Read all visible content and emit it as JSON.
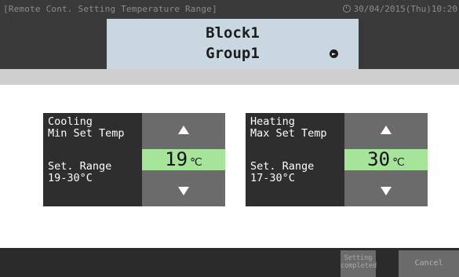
{
  "header": {
    "screen_title": "[Remote Cont. Setting Temperature Range]",
    "datetime": "30/04/2015(Thu)10:20",
    "block_name": "Block1",
    "group_name": "Group1"
  },
  "cooling": {
    "mode_label": "Cooling\nMin Set Temp",
    "value": "19",
    "unit": "℃",
    "range_label": "Set. Range",
    "range_value": "19-30°C"
  },
  "heating": {
    "mode_label": "Heating\nMax Set Temp",
    "value": "30",
    "unit": "℃",
    "range_label": "Set. Range",
    "range_value": "17-30°C"
  },
  "footer": {
    "setting_completed_label": "Setting completed",
    "cancel_label": "Cancel"
  },
  "icons": {
    "clock": "clock-icon",
    "group_next": "group-next-icon",
    "up": "triangle-up-icon",
    "down": "triangle-down-icon"
  },
  "colors": {
    "value_highlight": "#a6e49a",
    "block_panel": "#c9d7e1",
    "dark_bg": "#3a3a3a",
    "button_grey": "#6b6b6b"
  }
}
